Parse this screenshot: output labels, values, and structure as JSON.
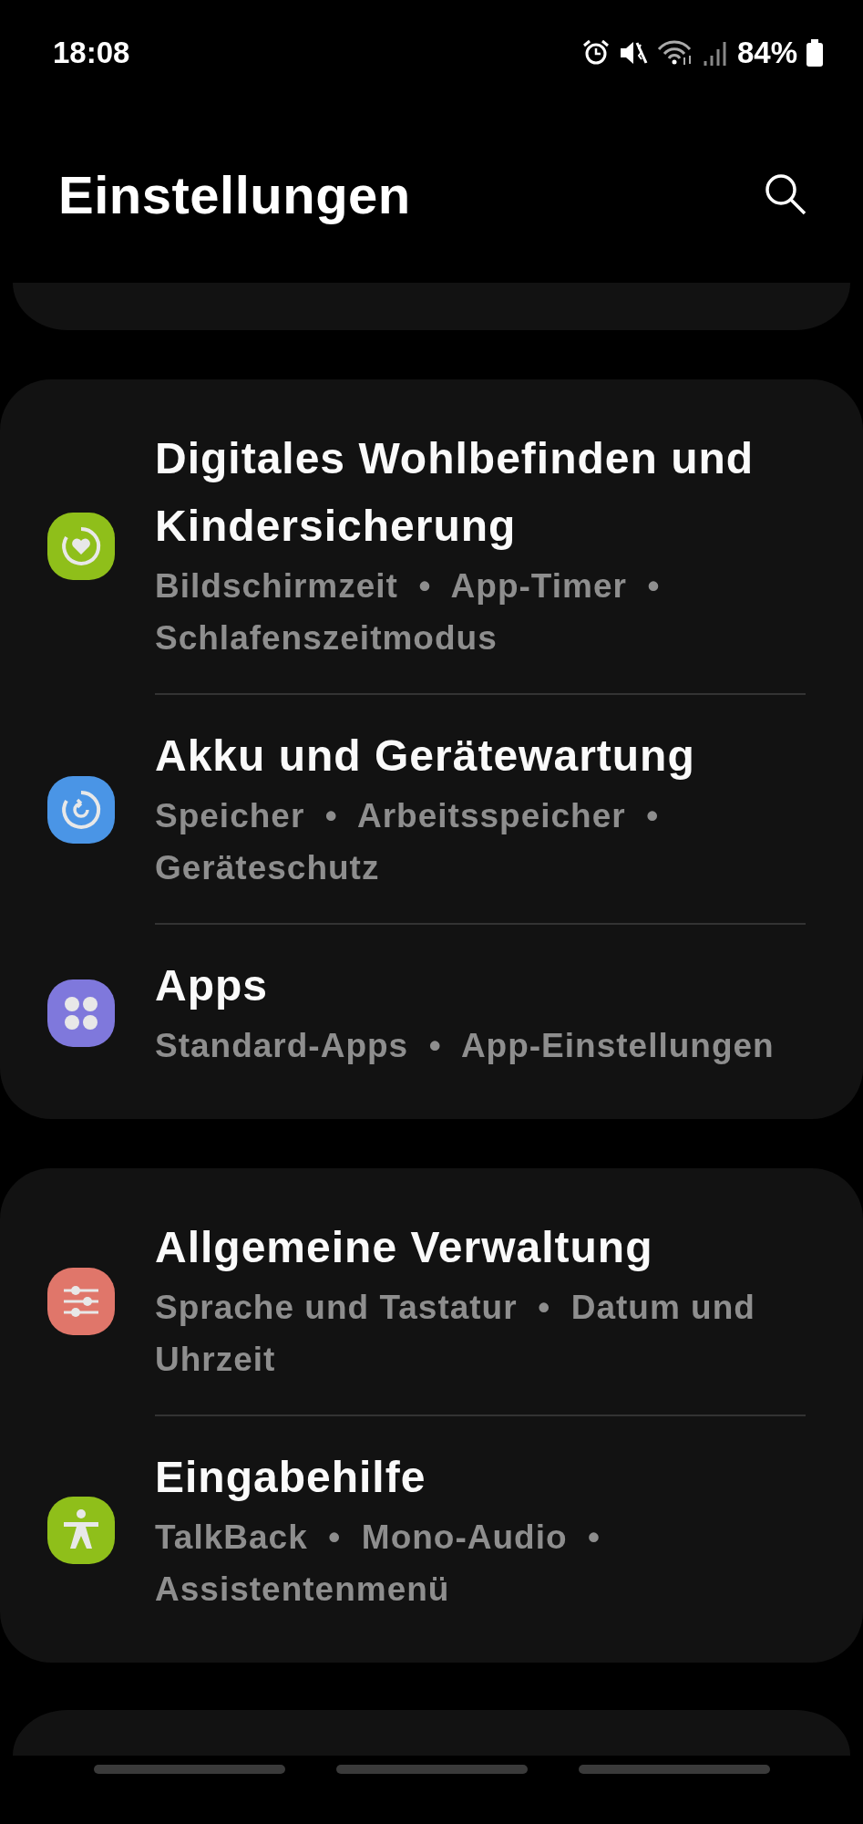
{
  "status_bar": {
    "time": "18:08",
    "battery": "84%"
  },
  "header": {
    "title": "Einstellungen"
  },
  "groups": [
    {
      "items": [
        {
          "kind": "wellbeing",
          "color": "#8fbf1a",
          "title": "Digitales Wohlbefinden und Kindersicherung",
          "subtitle": "Bildschirmzeit  •  App-Timer  •  Schlafenszeitmodus"
        },
        {
          "kind": "care",
          "color": "#4a95e6",
          "title": "Akku und Gerätewartung",
          "subtitle": "Speicher  •  Arbeitsspeicher  •  Geräteschutz"
        },
        {
          "kind": "apps",
          "color": "#7f78dc",
          "title": "Apps",
          "subtitle": "Standard-Apps  •  App-Einstellungen"
        }
      ]
    },
    {
      "items": [
        {
          "kind": "sliders",
          "color": "#e0766a",
          "title": "Allgemeine Verwaltung",
          "subtitle": "Sprache und Tastatur  •  Datum und Uhrzeit"
        },
        {
          "kind": "accessibility",
          "color": "#8fbf1a",
          "title": "Eingabehilfe",
          "subtitle": "TalkBack  •  Mono-Audio  •  Assistentenmenü"
        }
      ]
    }
  ]
}
